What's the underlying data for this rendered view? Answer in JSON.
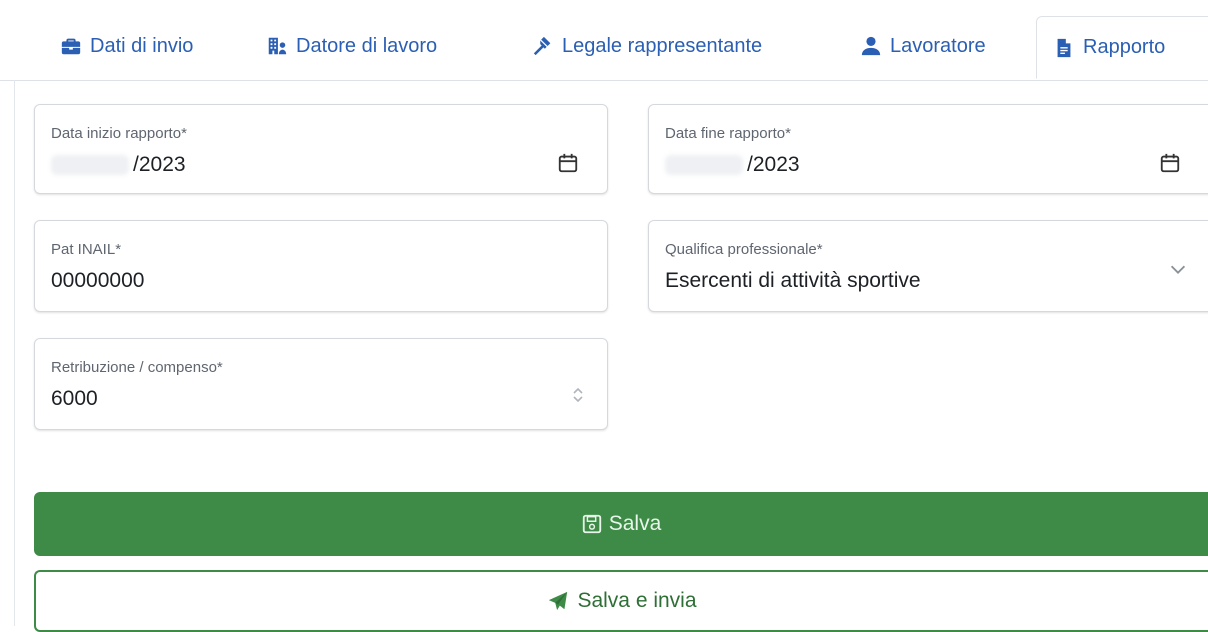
{
  "tabs": [
    {
      "label": "Dati di invio",
      "icon": "briefcase-icon"
    },
    {
      "label": "Datore di lavoro",
      "icon": "building-user-icon"
    },
    {
      "label": "Legale rappresentante",
      "icon": "gavel-icon"
    },
    {
      "label": "Lavoratore",
      "icon": "user-icon"
    },
    {
      "label": "Rapporto",
      "icon": "file-icon",
      "active": true
    }
  ],
  "form": {
    "start_date": {
      "label": "Data inizio rapporto*",
      "value": "/2023"
    },
    "end_date": {
      "label": "Data fine rapporto*",
      "value": "/2023"
    },
    "pat_inail": {
      "label": "Pat INAIL*",
      "value": "00000000"
    },
    "qualifica": {
      "label": "Qualifica professionale*",
      "value": "Esercenti di attività sportive"
    },
    "retribuzione": {
      "label": "Retribuzione / compenso*",
      "value": "6000"
    }
  },
  "actions": {
    "save_label": "Salva",
    "save_send_label": "Salva e invia"
  },
  "colors": {
    "tab_link": "#2b5fb3",
    "primary_green": "#3d8b46",
    "border": "#dee2e6"
  }
}
